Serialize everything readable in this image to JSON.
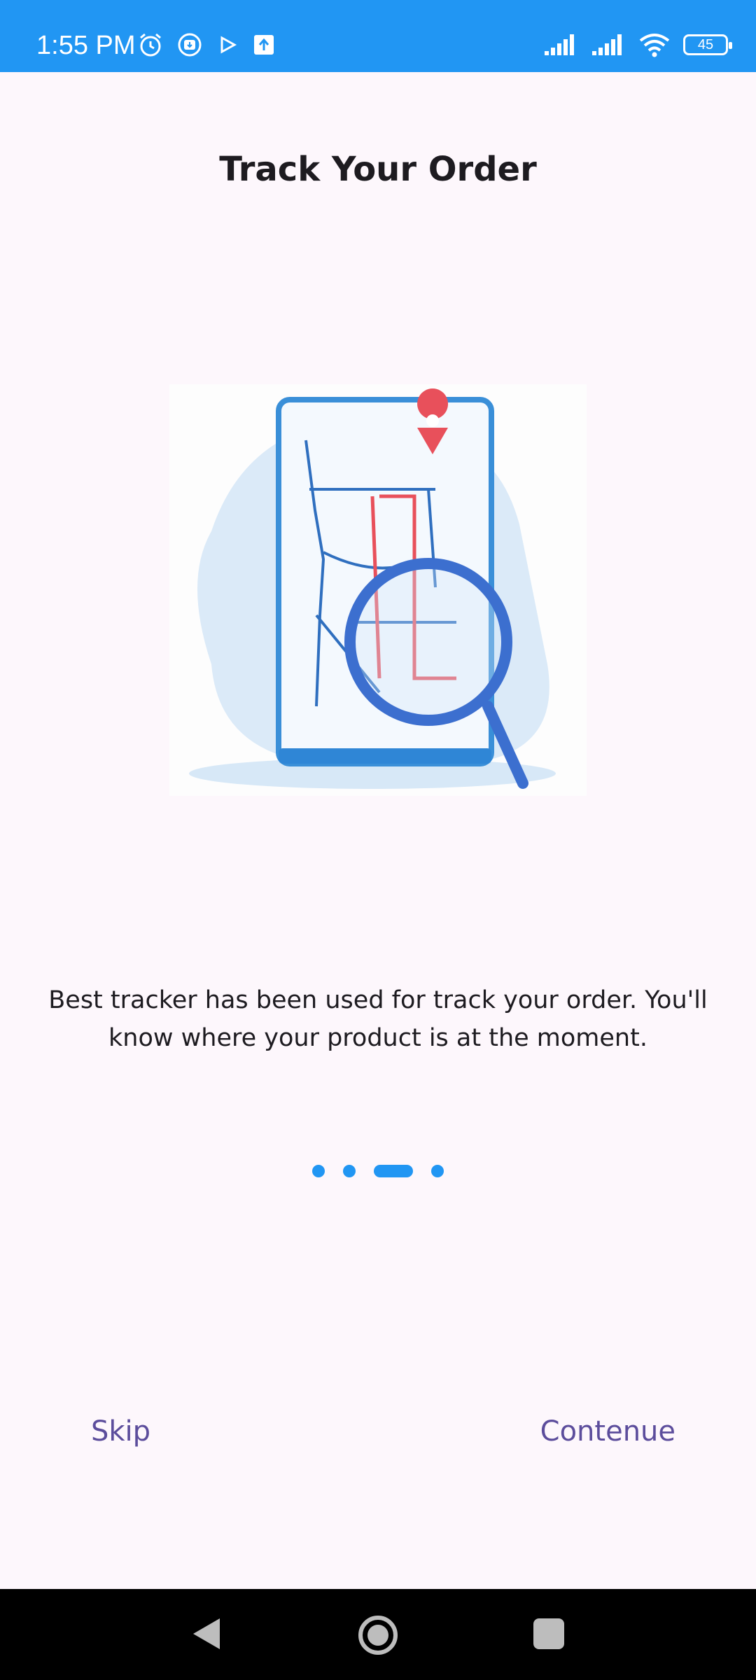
{
  "status_bar": {
    "time": "1:55 PM",
    "battery": "45",
    "icons_left": [
      "alarm-icon",
      "download-badge-icon",
      "play-store-icon",
      "upload-icon"
    ],
    "icons_right": [
      "signal-icon",
      "signal-icon",
      "wifi-icon",
      "battery-icon"
    ]
  },
  "onboarding": {
    "title": "Track Your Order",
    "description": "Best tracker has been used for track your order. You'll know where your product is at the moment.",
    "pager": {
      "pages": 4,
      "current_index": 2
    },
    "skip_label": "Skip",
    "continue_label": "Contenue",
    "illustration": "map-phone-magnifier-illustration"
  },
  "nav_bar": {
    "icons": [
      "back-icon",
      "home-icon",
      "recents-icon"
    ]
  },
  "colors": {
    "status_bar": "#2196f3",
    "accent": "#2196f3",
    "button_text": "#5c4d9c",
    "background": "#fdf7fc",
    "pin": "#e8505b",
    "route": "#e8505b",
    "phone_outline": "#3a8fd8"
  }
}
